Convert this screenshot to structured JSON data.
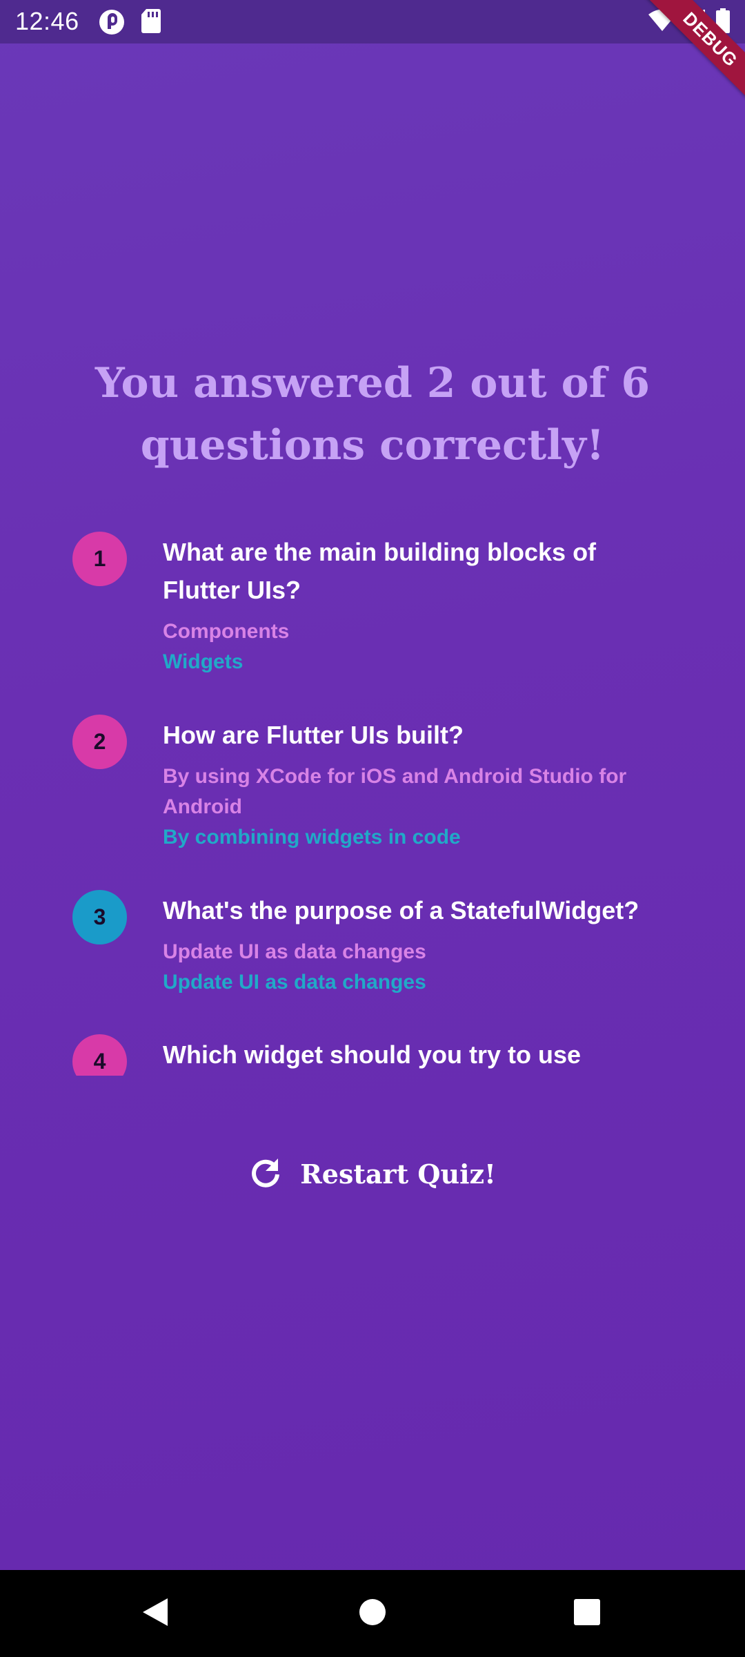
{
  "status_bar": {
    "time": "12:46",
    "left_icons": [
      "pocket-casts-icon",
      "sd-card-icon"
    ],
    "right_icons": [
      "wifi-icon",
      "cell-signal-icon",
      "battery-icon"
    ]
  },
  "debug_banner": "DEBUG",
  "result": {
    "title_line1": "You answered 2 out of 6",
    "title_line2": "questions correctly!"
  },
  "summary": [
    {
      "number": "1",
      "question_line1": "What are the main building blocks of",
      "question_line2": "Flutter UIs?",
      "user_answer": "Components",
      "correct_answer": "Widgets",
      "badge_color": "#d83aa8"
    },
    {
      "number": "2",
      "question_line1": "How are Flutter UIs built?",
      "user_answer_line1": "By using XCode for iOS and Android Studio for",
      "user_answer_line2": "Android",
      "correct_answer": "By combining widgets in code",
      "badge_color": "#d83aa8"
    },
    {
      "number": "3",
      "question_line1": "What's the purpose of a StatefulWidget?",
      "user_answer": "Update UI as data changes",
      "correct_answer": "Update UI as data changes",
      "badge_color": "#1a9bc9"
    },
    {
      "number": "4",
      "question_line1": "Which widget should you try to use",
      "badge_color": "#d83aa8"
    }
  ],
  "restart": {
    "label": "Restart Quiz!",
    "icon": "refresh-icon"
  },
  "nav_bar": {
    "buttons": [
      "back-icon",
      "home-icon",
      "recents-icon"
    ]
  },
  "colors": {
    "background": "#6a2fb3",
    "title": "#c6a2f5",
    "user_answer": "#d883e6",
    "correct_answer": "#21a9c8",
    "wrong_badge": "#d83aa8",
    "right_badge": "#1a9bc9"
  }
}
